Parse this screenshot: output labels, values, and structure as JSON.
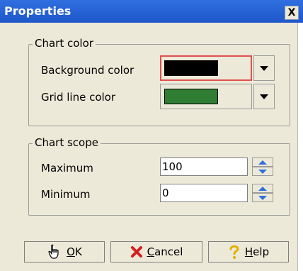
{
  "window": {
    "title": "Properties",
    "close_glyph": "X"
  },
  "chart_color": {
    "legend": "Chart color",
    "background_label": "Background color",
    "background_value": "#000000",
    "grid_label": "Grid line color",
    "grid_value": "#2e7d32"
  },
  "chart_scope": {
    "legend": "Chart scope",
    "maximum_label": "Maximum",
    "maximum_value": "100",
    "minimum_label": "Minimum",
    "minimum_value": "0"
  },
  "buttons": {
    "ok": {
      "mnemonic": "O",
      "rest": "K",
      "icon": "hand-pointer-icon"
    },
    "cancel": {
      "mnemonic": "C",
      "rest": "ancel",
      "icon": "red-x-icon"
    },
    "help": {
      "mnemonic": "H",
      "rest": "elp",
      "icon": "question-mark-icon"
    }
  },
  "colors": {
    "title_bar": "#2f6fe0",
    "dialog_bg": "#ece9d8",
    "focus_border": "#e05050"
  }
}
